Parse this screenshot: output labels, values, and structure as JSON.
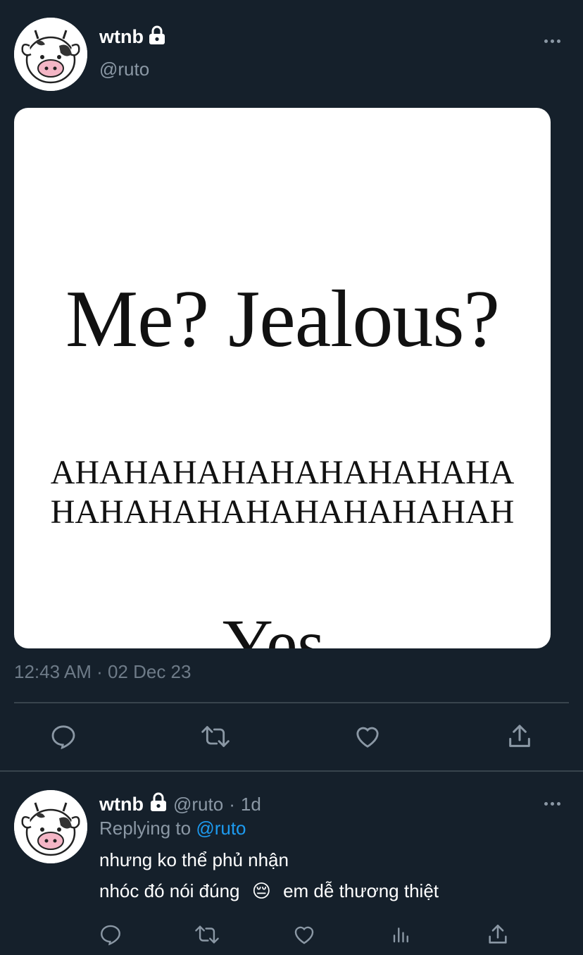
{
  "main_tweet": {
    "author_name": "wtnb",
    "author_handle": "@ruto",
    "image_text": {
      "line1": "Me? Jealous?",
      "line2a": "AHAHAHAHAHAHAHAHAHA",
      "line2b": "HAHAHAHAHAHAHAHAHAH",
      "line3": "Yes."
    },
    "timestamp": "12:43 AM · 02 Dec 23",
    "actions": [
      "reply-icon",
      "retweet-icon",
      "like-icon",
      "share-icon"
    ]
  },
  "reply_tweet": {
    "author_name": "wtnb",
    "author_handle": "@ruto",
    "separator": "·",
    "age": "1d",
    "replying_prefix": "Replying to ",
    "replying_to": "@ruto",
    "line1": "nhưng ko thể phủ nhận",
    "line2_before": "nhóc đó nói đúng",
    "line2_emoji": "😔",
    "line2_after": "em dễ thương thiệt",
    "actions": [
      "reply-icon",
      "retweet-icon",
      "like-icon",
      "analytics-icon",
      "share-icon"
    ]
  },
  "colors": {
    "background": "#15202b",
    "secondary_text": "#8b98a5",
    "divider": "#38444d",
    "accent": "#1d9bf0"
  }
}
